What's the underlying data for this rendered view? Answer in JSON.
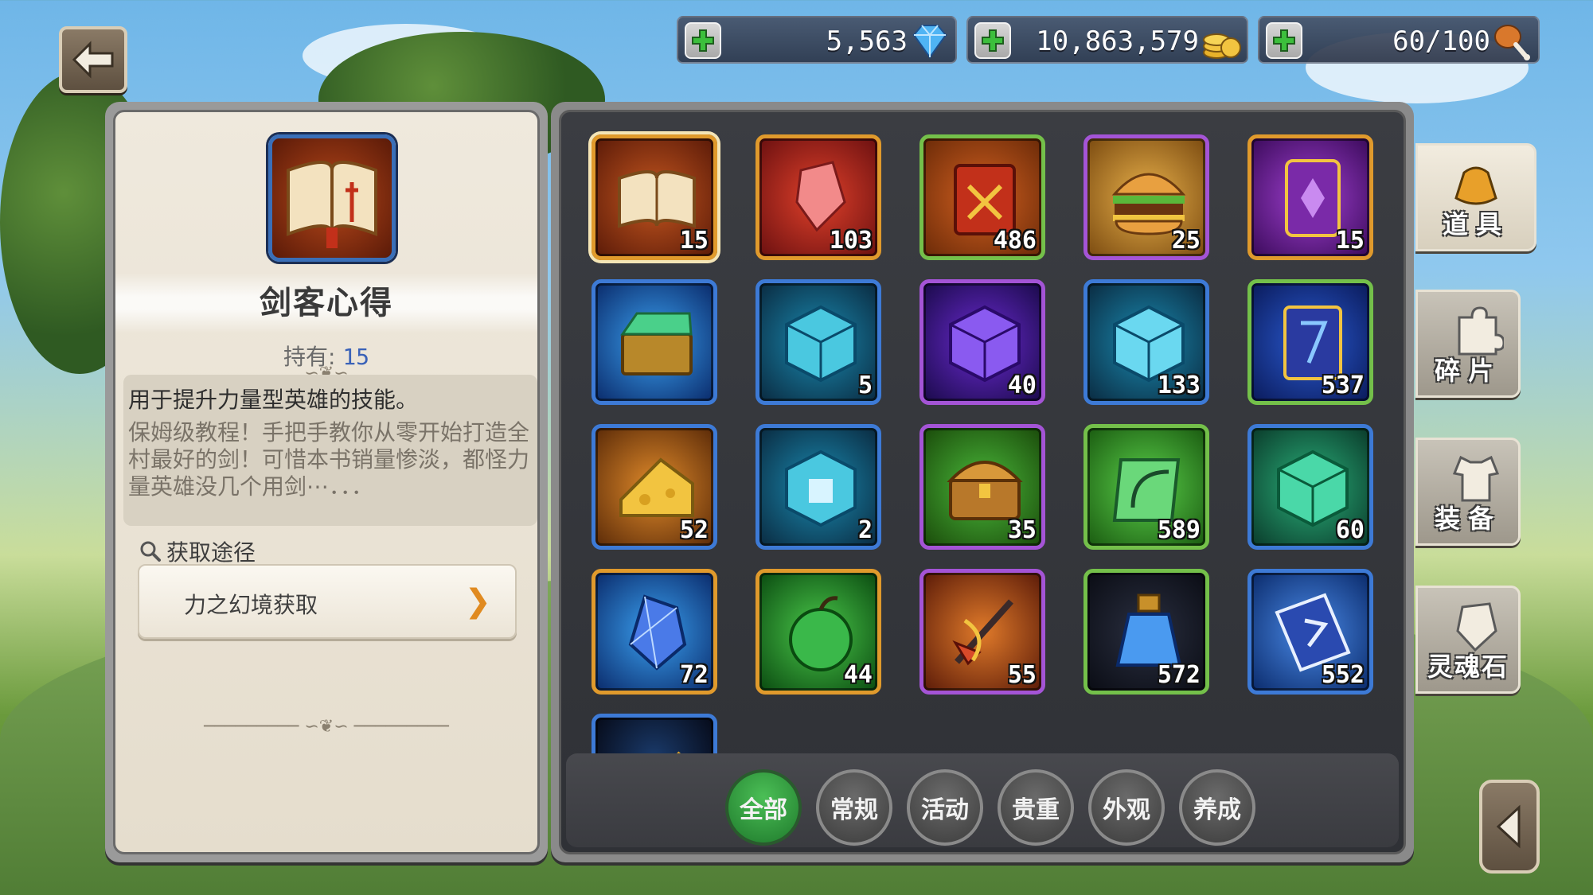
{
  "currency": {
    "gems": "5,563",
    "gold": "10,863,579",
    "stamina": "60/100"
  },
  "detail": {
    "item_name": "剑客心得",
    "own_label": "持有:",
    "own_count": "15",
    "desc_main": "用于提升力量型英雄的技能。",
    "desc_flavor": "保姆级教程！手把手教你从零开始打造全村最好的剑！可惜本书销量惨淡，都怪力量英雄没几个用剑⋯．．．",
    "source_label": "获取途径",
    "source_entry": "力之幻境获取"
  },
  "grid": {
    "items": [
      {
        "icon": "sword-manual-book",
        "count": "15",
        "quality": "orange"
      },
      {
        "icon": "red-crystal",
        "count": "103",
        "quality": "orange"
      },
      {
        "icon": "red-tome",
        "count": "486",
        "quality": "green"
      },
      {
        "icon": "burger",
        "count": "25",
        "quality": "purple"
      },
      {
        "icon": "purple-card",
        "count": "15",
        "quality": "orange"
      },
      {
        "icon": "green-chest",
        "count": "",
        "quality": "blue"
      },
      {
        "icon": "cyan-cube",
        "count": "5",
        "quality": "blue"
      },
      {
        "icon": "purple-cube",
        "count": "40",
        "quality": "purple"
      },
      {
        "icon": "cyan-cube-2",
        "count": "133",
        "quality": "blue"
      },
      {
        "icon": "blue-book",
        "count": "537",
        "quality": "green"
      },
      {
        "icon": "cheese",
        "count": "52",
        "quality": "blue"
      },
      {
        "icon": "armor-cube",
        "count": "2",
        "quality": "blue"
      },
      {
        "icon": "gold-chest",
        "count": "35",
        "quality": "purple"
      },
      {
        "icon": "bow-scroll",
        "count": "589",
        "quality": "green"
      },
      {
        "icon": "green-cube",
        "count": "60",
        "quality": "blue"
      },
      {
        "icon": "blue-gem",
        "count": "72",
        "quality": "orange"
      },
      {
        "icon": "green-apple",
        "count": "44",
        "quality": "orange"
      },
      {
        "icon": "fire-arrow",
        "count": "55",
        "quality": "purple"
      },
      {
        "icon": "blue-potion",
        "count": "572",
        "quality": "green"
      },
      {
        "icon": "blue-card",
        "count": "552",
        "quality": "blue"
      },
      {
        "icon": "elixir-bottle",
        "count": "",
        "quality": "blue"
      }
    ]
  },
  "tabs": [
    "全部",
    "常规",
    "活动",
    "贵重",
    "外观",
    "养成"
  ],
  "side_tabs": [
    "道具",
    "碎片",
    "装备",
    "灵魂石"
  ]
}
